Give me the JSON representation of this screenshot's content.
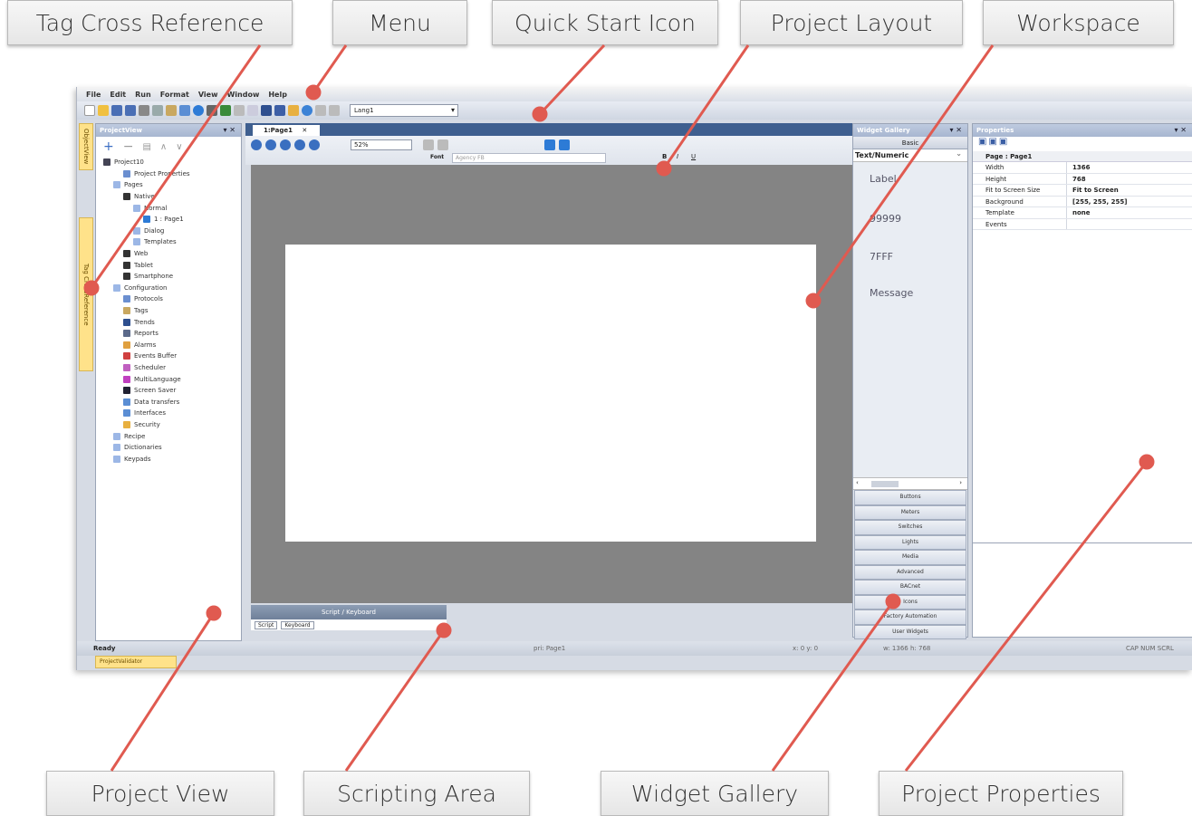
{
  "callouts": {
    "tag_cross_reference": "Tag Cross Reference",
    "menu": "Menu",
    "quick_start_icon": "Quick Start Icon",
    "project_layout": "Project Layout",
    "workspace": "Workspace",
    "project_view": "Project View",
    "scripting_area": "Scripting Area",
    "widget_gallery": "Widget Gallery",
    "project_properties": "Project Properties"
  },
  "menu": [
    "File",
    "Edit",
    "Run",
    "Format",
    "View",
    "Window",
    "Help"
  ],
  "toolbar": {
    "language": "Lang1"
  },
  "side_tabs": {
    "object_view": "ObjectView",
    "tag_cross_reference": "Tag CrossReference"
  },
  "project_view": {
    "title": "ProjectView",
    "tree": [
      "Project10",
      "Project Properties",
      "Pages",
      "Native",
      "Normal",
      "1 : Page1",
      "Dialog",
      "Templates",
      "Web",
      "Tablet",
      "Smartphone",
      "Configuration",
      "Protocols",
      "Tags",
      "Trends",
      "Reports",
      "Alarms",
      "Events Buffer",
      "Scheduler",
      "MultiLanguage",
      "Screen Saver",
      "Data transfers",
      "Interfaces",
      "Security",
      "Recipe",
      "Dictionaries",
      "Keypads"
    ]
  },
  "workspace": {
    "tab": "1:Page1",
    "zoom": "52%",
    "font_label": "Font",
    "font_value": "Agency FB"
  },
  "scripting": {
    "title": "Script / Keyboard",
    "tab_script": "Script",
    "tab_keyboard": "Keyboard"
  },
  "widget_gallery": {
    "title": "Widget Gallery",
    "basic": "Basic",
    "category": "Text/Numeric",
    "items": [
      "Label",
      "99999",
      "7FFF",
      "Message"
    ],
    "buttons": [
      "Buttons",
      "Meters",
      "Switches",
      "Lights",
      "Media",
      "Advanced",
      "BACnet",
      "Icons",
      "Factory Automation",
      "User Widgets"
    ]
  },
  "properties": {
    "title": "Properties",
    "header": "Page : Page1",
    "rows": [
      {
        "key": "Width",
        "value": "1366"
      },
      {
        "key": "Height",
        "value": "768"
      },
      {
        "key": "Fit to Screen Size",
        "value": "Fit to Screen"
      },
      {
        "key": "Background",
        "value": "[255, 255, 255]"
      },
      {
        "key": "Template",
        "value": "none"
      },
      {
        "key": "Events",
        "value": ""
      }
    ]
  },
  "statusbar": {
    "ready": "Ready",
    "page": "pri: Page1",
    "cursor": "x: 0    y: 0",
    "size": "w: 1366    h: 768",
    "keys": "CAP NUM SCRL"
  },
  "bottom_tab": "ProjectValidator"
}
